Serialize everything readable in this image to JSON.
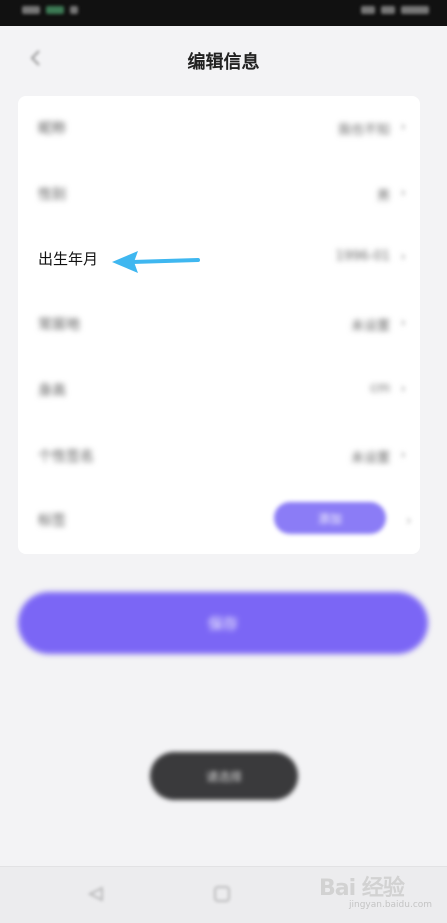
{
  "status_bar": {
    "text": ""
  },
  "header": {
    "back_icon": "chevron-left-icon",
    "title": "编辑信息"
  },
  "form": {
    "rows": [
      {
        "id": "nickname",
        "label": "",
        "value": ""
      },
      {
        "id": "gender",
        "label": "",
        "value": ""
      },
      {
        "id": "birthday",
        "label": "出生年月",
        "value": ""
      },
      {
        "id": "hometown",
        "label": "",
        "value": ""
      },
      {
        "id": "height",
        "label": "",
        "value": ""
      },
      {
        "id": "signature",
        "label": "",
        "value": ""
      },
      {
        "id": "tags",
        "label": "",
        "value": ""
      }
    ],
    "tag_pill": {
      "label": ""
    }
  },
  "save_button": {
    "label": ""
  },
  "toast": {
    "text": ""
  },
  "annotation": {
    "arrow_color": "#3fb7f0"
  },
  "colors": {
    "accent": "#7b66f5",
    "background": "#f3f3f5",
    "card": "#ffffff"
  },
  "watermark": {
    "main": "Bai 经验",
    "sub": "jingyan.baidu.com"
  }
}
